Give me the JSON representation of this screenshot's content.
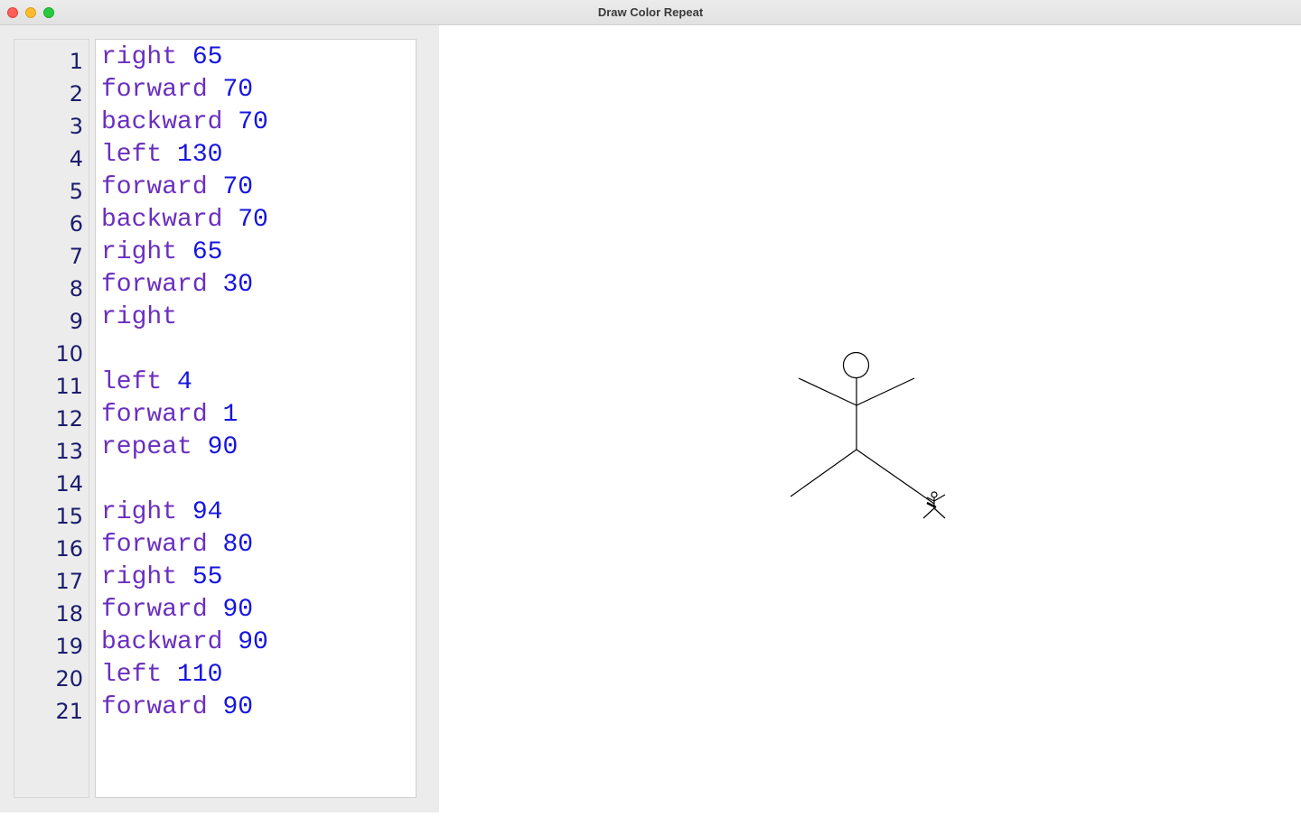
{
  "window": {
    "title": "Draw Color Repeat"
  },
  "colors": {
    "keyword": "#6a2fbf",
    "number": "#1515e0",
    "line_number": "#1c1c6e",
    "drawing": "#000000"
  },
  "editor": {
    "lines": [
      {
        "num": "1",
        "cmd": "right",
        "arg": "65"
      },
      {
        "num": "2",
        "cmd": "forward",
        "arg": "70"
      },
      {
        "num": "3",
        "cmd": "backward",
        "arg": "70"
      },
      {
        "num": "4",
        "cmd": "left",
        "arg": "130"
      },
      {
        "num": "5",
        "cmd": "forward",
        "arg": "70"
      },
      {
        "num": "6",
        "cmd": "backward",
        "arg": "70"
      },
      {
        "num": "7",
        "cmd": "right",
        "arg": "65"
      },
      {
        "num": "8",
        "cmd": "forward",
        "arg": "30"
      },
      {
        "num": "9",
        "cmd": "right",
        "arg": ""
      },
      {
        "num": "10",
        "cmd": "",
        "arg": ""
      },
      {
        "num": "11",
        "cmd": "left",
        "arg": "4"
      },
      {
        "num": "12",
        "cmd": "forward",
        "arg": "1"
      },
      {
        "num": "13",
        "cmd": "repeat",
        "arg": "90"
      },
      {
        "num": "14",
        "cmd": "",
        "arg": ""
      },
      {
        "num": "15",
        "cmd": "right",
        "arg": "94"
      },
      {
        "num": "16",
        "cmd": "forward",
        "arg": "80"
      },
      {
        "num": "17",
        "cmd": "right",
        "arg": "55"
      },
      {
        "num": "18",
        "cmd": "forward",
        "arg": "90"
      },
      {
        "num": "19",
        "cmd": "backward",
        "arg": "90"
      },
      {
        "num": "20",
        "cmd": "left",
        "arg": "110"
      },
      {
        "num": "21",
        "cmd": "forward",
        "arg": "90"
      }
    ]
  }
}
